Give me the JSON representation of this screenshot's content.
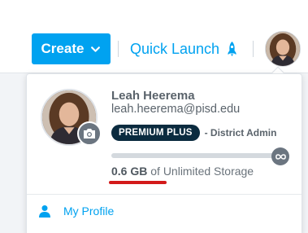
{
  "header": {
    "create_label": "Create",
    "quick_launch_label": "Quick Launch",
    "icons": {
      "create_dropdown": "chevron-down-icon",
      "quick_launch": "rocket-icon",
      "avatar": "avatar"
    }
  },
  "profile": {
    "name": "Leah Heerema",
    "email": "leah.heerema@pisd.edu",
    "plan_badge": "PREMIUM PLUS",
    "role": "- District Admin",
    "storage": {
      "used": "0.6 GB",
      "suffix": "of Unlimited Storage",
      "fraction_used": 0.0
    }
  },
  "menu": {
    "items": [
      {
        "label": "My Profile",
        "icon": "user-icon"
      }
    ]
  },
  "colors": {
    "accent": "#00a2f0",
    "plan_badge_bg": "#0b2b3f",
    "annotation_red": "#d31a1a"
  }
}
